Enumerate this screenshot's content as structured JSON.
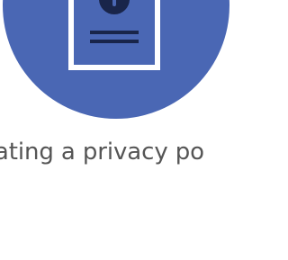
{
  "caption": {
    "text": "eating a privacy po"
  },
  "illustration": {
    "circle_color": "#4a67b4",
    "document_border_color": "#ffffff",
    "lock_color": "#19254a",
    "icons": [
      "document-icon",
      "lock-icon"
    ]
  }
}
